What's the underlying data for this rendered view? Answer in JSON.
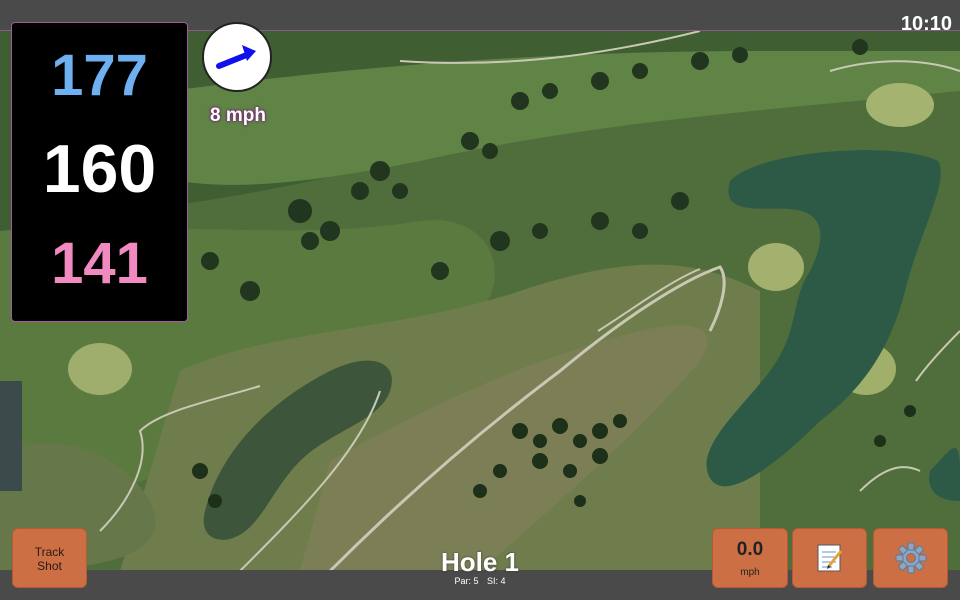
{
  "status": {
    "time": "10:10"
  },
  "distances": {
    "back": "177",
    "middle": "160",
    "front": "141"
  },
  "wind": {
    "speed_text": "8 mph",
    "icon": "wind-arrow-icon"
  },
  "buttons": {
    "track_shot_line1": "Track",
    "track_shot_line2": "Shot",
    "speed_value": "0.0",
    "speed_unit": "mph",
    "notes_icon": "notepad-icon",
    "settings_icon": "gear-icon"
  },
  "hole": {
    "title": "Hole 1",
    "par_text": "Par: 5",
    "si_text": "SI: 4"
  },
  "colors": {
    "back_distance": "#6fb0f0",
    "middle_distance": "#ffffff",
    "front_distance": "#f08ac0",
    "button_fill": "#cd6f45",
    "frame": "#4a4a4a"
  }
}
